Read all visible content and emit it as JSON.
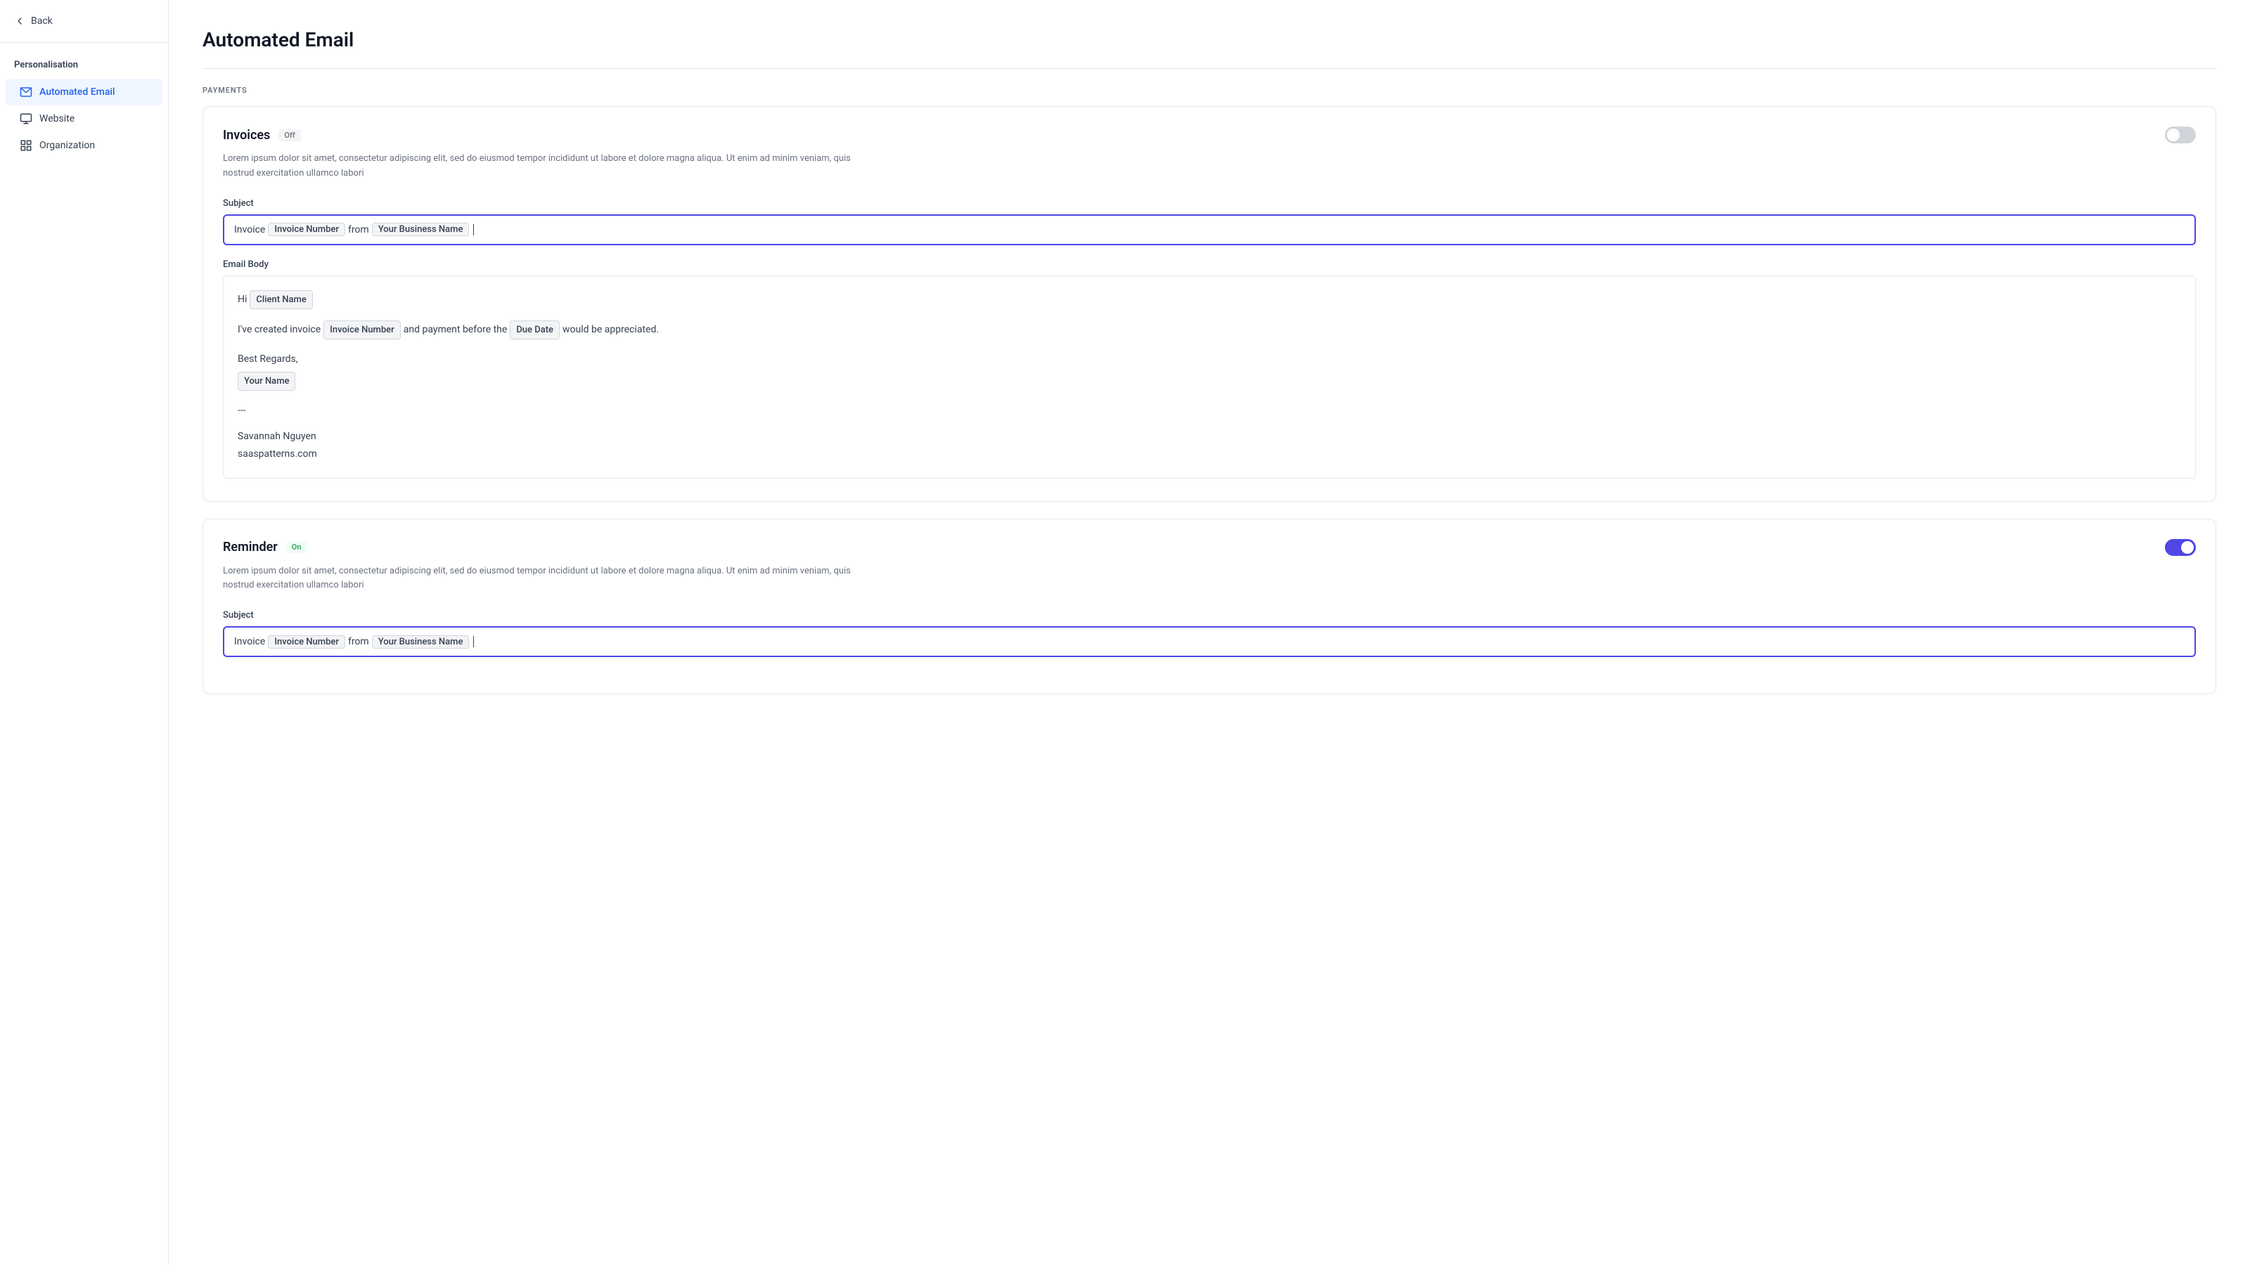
{
  "sidebar": {
    "back_label": "Back",
    "section_title": "Personalisation",
    "items": [
      {
        "id": "automated-email",
        "label": "Automated Email",
        "icon": "email-icon",
        "active": true
      },
      {
        "id": "website",
        "label": "Website",
        "icon": "monitor-icon",
        "active": false
      },
      {
        "id": "organization",
        "label": "Organization",
        "icon": "grid-icon",
        "active": false
      }
    ]
  },
  "page": {
    "title": "Automated Email",
    "section_label": "PAYMENTS"
  },
  "invoices_card": {
    "title": "Invoices",
    "status": "Off",
    "toggle_on": false,
    "description": "Lorem ipsum dolor sit amet, consectetur adipiscing elit, sed do eiusmod tempor incididunt ut labore et dolore magna aliqua. Ut enim ad minim veniam, quis nostrud exercitation ullamco labori",
    "subject_label": "Subject",
    "subject_prefix": "Invoice",
    "subject_tag1": "Invoice Number",
    "subject_from": "from",
    "subject_tag2": "Your Business Name",
    "email_body_label": "Email Body",
    "body_hi": "Hi",
    "body_client_name_tag": "Client Name",
    "body_created": "I've created invoice",
    "body_invoice_number_tag": "Invoice Number",
    "body_payment_before": "and payment before the",
    "body_due_date_tag": "Due Date",
    "body_appreciated": "would be appreciated.",
    "body_regards": "Best Regards,",
    "body_your_name_tag": "Your Name",
    "body_separator": "---",
    "body_sig_name": "Savannah Nguyen",
    "body_sig_url": "saaspatterns.com"
  },
  "reminder_card": {
    "title": "Reminder",
    "status": "On",
    "toggle_on": true,
    "description": "Lorem ipsum dolor sit amet, consectetur adipiscing elit, sed do eiusmod tempor incididunt ut labore et dolore magna aliqua. Ut enim ad minim veniam, quis nostrud exercitation ullamco labori",
    "subject_label": "Subject",
    "subject_prefix": "Invoice",
    "subject_tag1": "Invoice Number",
    "subject_from": "from",
    "subject_tag2": "Your Business Name"
  }
}
